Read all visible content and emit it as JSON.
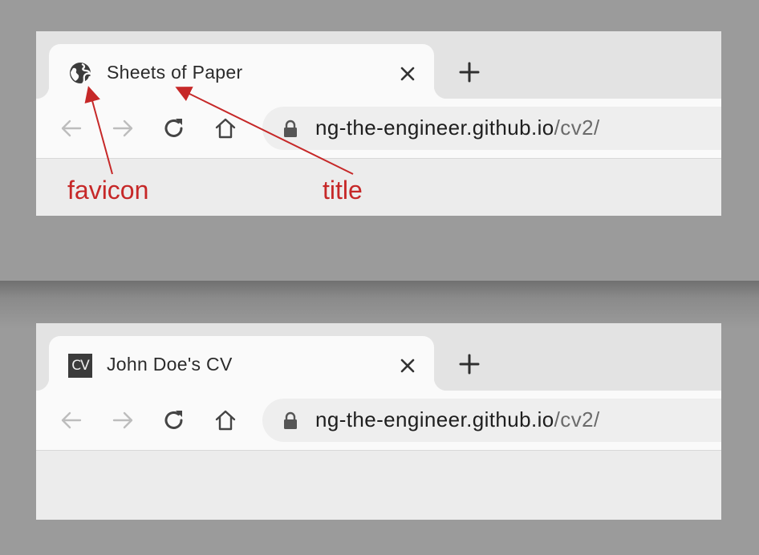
{
  "screens": [
    {
      "tab": {
        "title": "Sheets of Paper",
        "favicon": "globe-icon"
      },
      "address": {
        "host": "ng-the-engineer.github.io",
        "path": "/cv2/"
      },
      "annotations": {
        "favicon_label": "favicon",
        "title_label": "title"
      }
    },
    {
      "tab": {
        "title": "John Doe's CV",
        "favicon_text": "CV"
      },
      "address": {
        "host": "ng-the-engineer.github.io",
        "path": "/cv2/"
      }
    }
  ],
  "icons": {
    "back": "arrow-left-icon",
    "forward": "arrow-right-icon",
    "reload": "reload-icon",
    "home": "home-icon",
    "lock": "lock-icon",
    "close": "close-icon",
    "new_tab": "plus-icon"
  },
  "colors": {
    "annotation": "#c62828",
    "tab_active": "#fafafa",
    "tabstrip": "#e3e3e3",
    "background": "#9b9b9b"
  }
}
